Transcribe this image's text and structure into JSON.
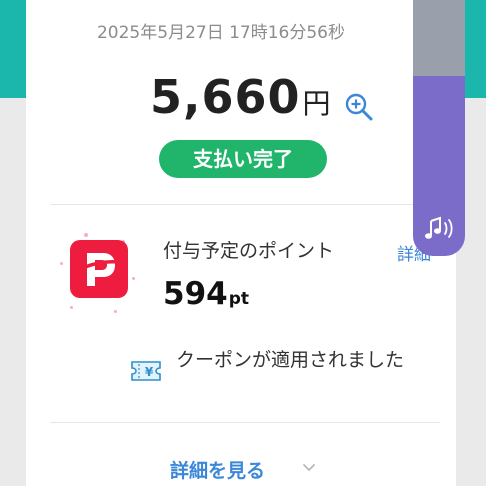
{
  "receipt": {
    "timestamp": "2025年5月27日 17時16分56秒",
    "amount": "5,660",
    "currency": "円",
    "status": "支払い完了"
  },
  "points": {
    "label": "付与予定のポイント",
    "link": "詳細",
    "value": "594",
    "unit": "pt"
  },
  "coupon": {
    "text": "クーポンが適用されました"
  },
  "footer": {
    "details_label": "詳細を見る"
  },
  "icons": {
    "zoom": "zoom-in-icon",
    "coupon": "coupon-ticket-icon",
    "chevron": "chevron-down-icon",
    "music": "music-note-icon",
    "brand": "paypay-logo"
  },
  "colors": {
    "teal": "#1bb7ad",
    "status_green": "#21b56c",
    "link_blue": "#3b87d8",
    "brand_red": "#ee1c3f",
    "widget_purple": "#7b6cc9"
  }
}
